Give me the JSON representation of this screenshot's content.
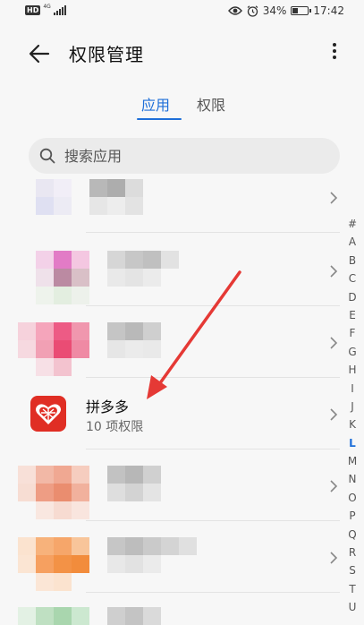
{
  "status_bar": {
    "network_type": "HD",
    "network_gen": "4G",
    "battery_percent": "34%",
    "time": "17:42",
    "battery_level": 0.34
  },
  "header": {
    "title": "权限管理"
  },
  "tabs": [
    {
      "label": "应用"
    },
    {
      "label": "权限"
    }
  ],
  "search": {
    "placeholder": "搜索应用"
  },
  "app": {
    "name": "拼多多",
    "permissions": "10 项权限"
  },
  "alphabet": [
    "#",
    "A",
    "B",
    "C",
    "D",
    "E",
    "F",
    "G",
    "H",
    "I",
    "J",
    "K",
    "L",
    "M",
    "N",
    "O",
    "P",
    "Q",
    "R",
    "S",
    "T",
    "U"
  ],
  "alphabet_active": "L",
  "colors": {
    "accent": "#1e6fd9",
    "pdd_red": "#e02e24",
    "arrow": "#e53935"
  }
}
